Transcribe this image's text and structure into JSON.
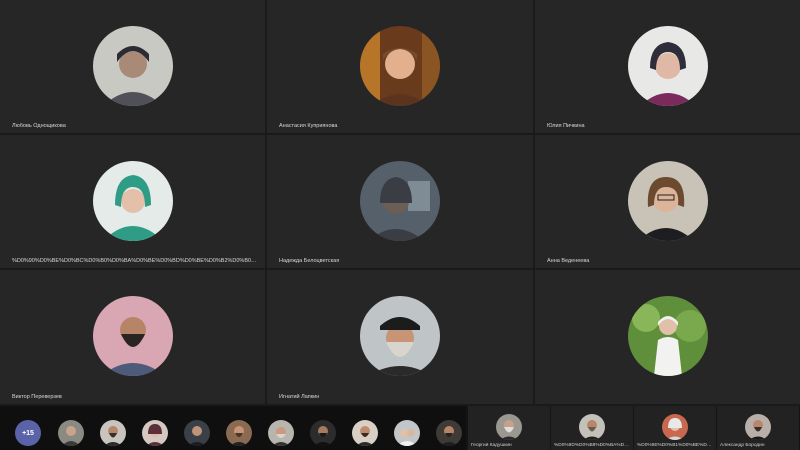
{
  "participants": [
    {
      "name": "Любовь Однощикова"
    },
    {
      "name": "Анастасия Куприянова"
    },
    {
      "name": "Юлия Пичкина"
    },
    {
      "name": "%D0%90%D0%BE%D0%BC%D0%B0%D0%BA%D0%BE%D0%BD%D0%BE%D0%B2%D0%B0%20%D0%95%D0%B..."
    },
    {
      "name": "Надежда Белоцветская"
    },
    {
      "name": "Анна Веденеева"
    },
    {
      "name": "Виктор Переверзев"
    },
    {
      "name": "Игнатий Лапкин"
    },
    {
      "name": ""
    }
  ],
  "strip": {
    "more_label": "+15"
  },
  "bottom_tiles": [
    {
      "name": "Георгий Кадушкин"
    },
    {
      "name": "%D0%9D%D0%B8%D0%BA%D0%BE%D0%BB%D0%B0%D0%B9..."
    },
    {
      "name": "%D0%9E%D0%B1%D0%BE%D0%BB%D0%BE%D0%BD%D0%B..."
    },
    {
      "name": "Александр Бородин"
    }
  ]
}
